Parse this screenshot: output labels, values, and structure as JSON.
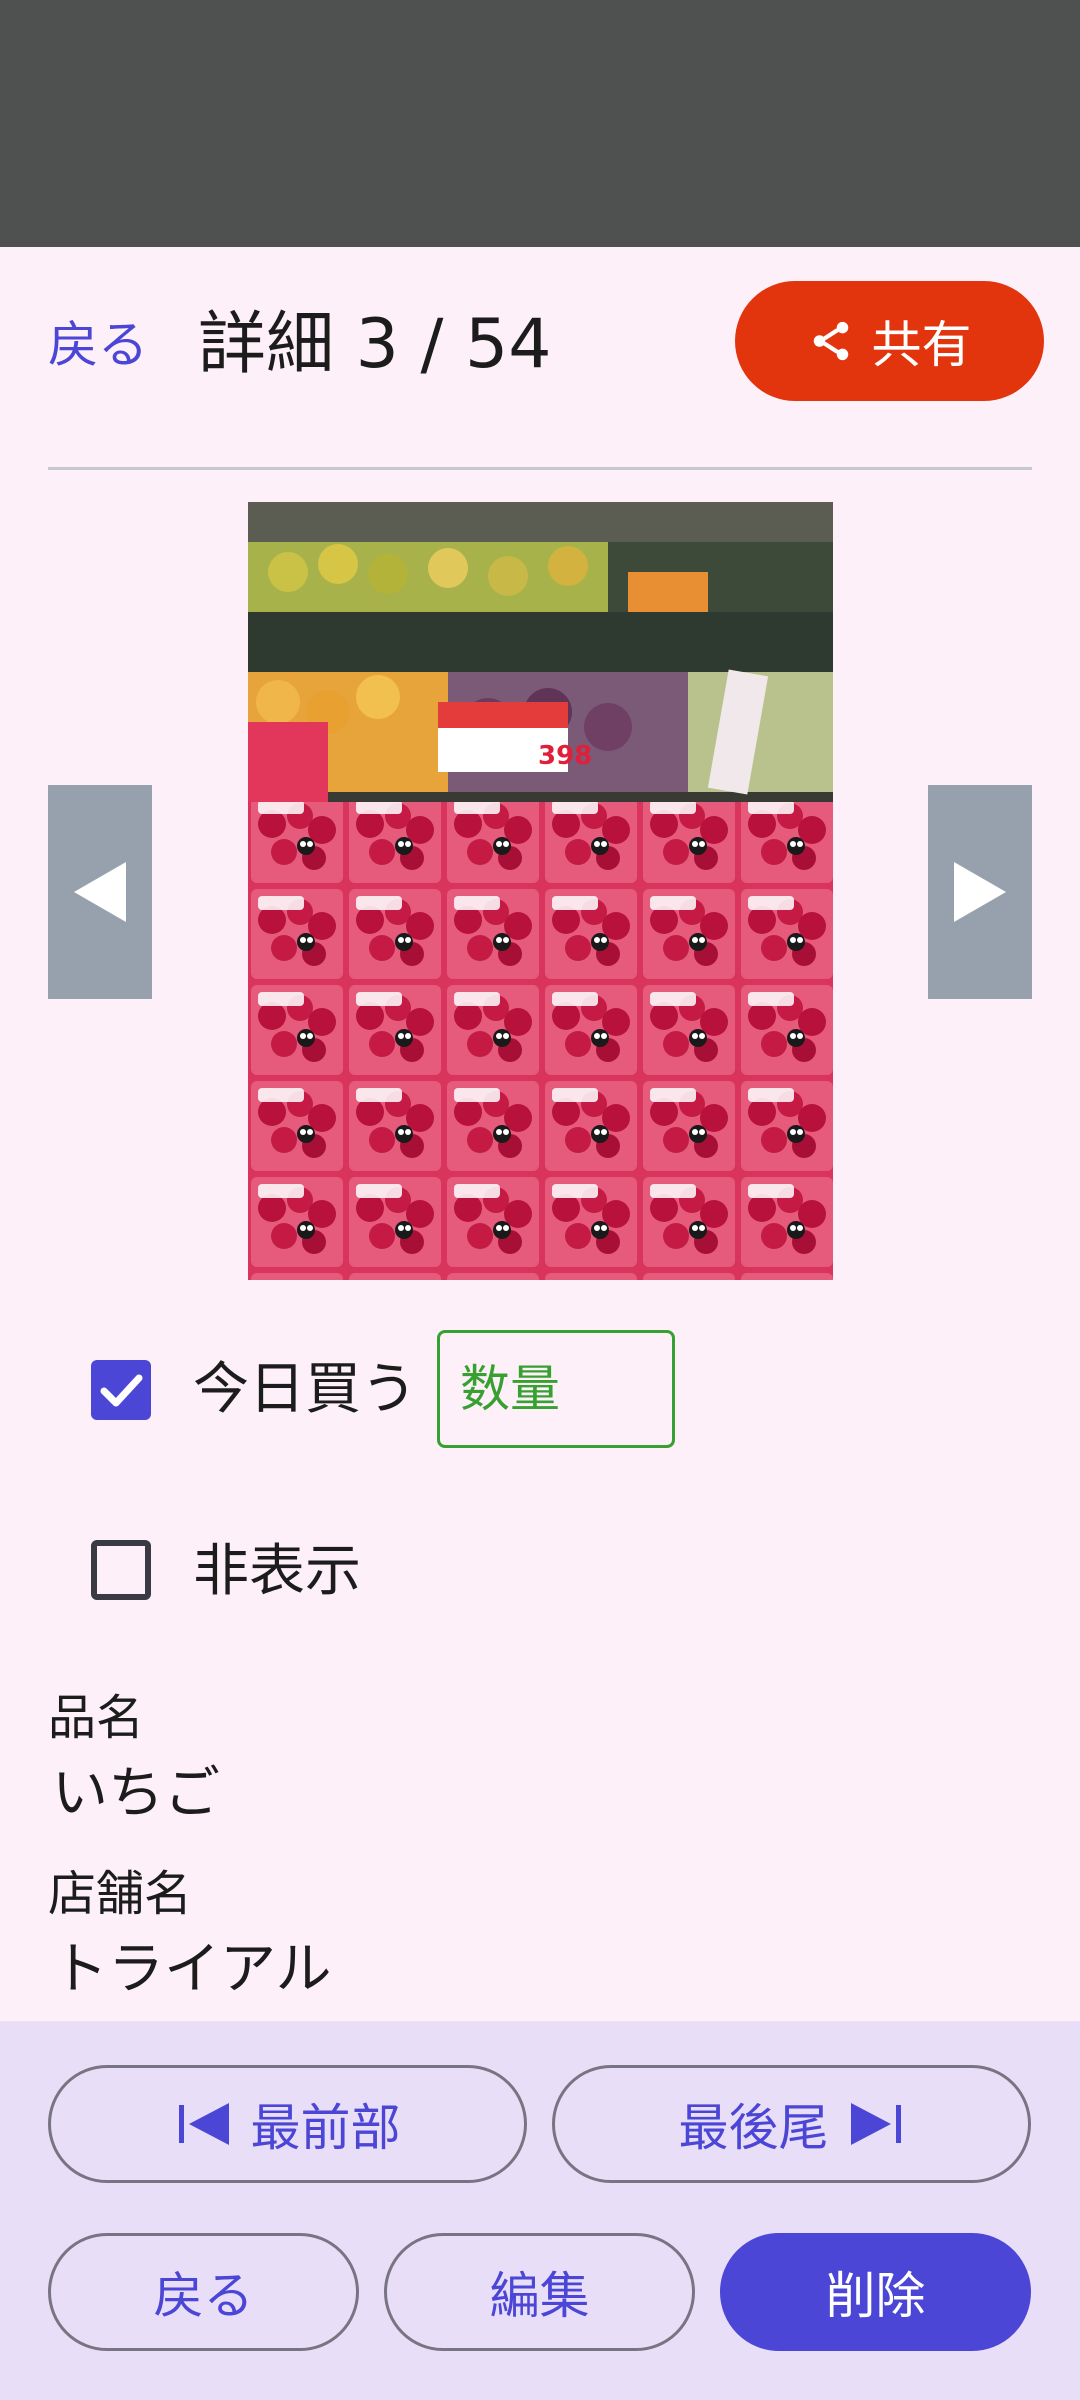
{
  "header": {
    "back_label": "戻る",
    "title": "詳細 3 / 54",
    "share_label": "共有",
    "share_icon": "share-icon",
    "share_color": "#e3350d"
  },
  "photo": {
    "description_icon": "product-photo-strawberries"
  },
  "navigation": {
    "prev_icon": "triangle-left-icon",
    "next_icon": "triangle-right-icon"
  },
  "options": {
    "buy_today": {
      "label": "今日買う",
      "checked": true
    },
    "quantity": {
      "placeholder": "数量",
      "value": ""
    },
    "hide": {
      "label": "非表示",
      "checked": false
    }
  },
  "details": {
    "product_name_label": "品名",
    "product_name_value": "いちご",
    "store_name_label": "店舗名",
    "store_name_value": "トライアル"
  },
  "bottom_bar": {
    "first_label": "最前部",
    "last_label": "最後尾",
    "back_label": "戻る",
    "edit_label": "編集",
    "delete_label": "削除"
  },
  "colors": {
    "accent": "#4b46d6",
    "background": "#fdf0f8",
    "bottom_bar": "#e9def7",
    "quantity_border": "#38a030",
    "nav_arrow_bg": "#97a1ae"
  }
}
